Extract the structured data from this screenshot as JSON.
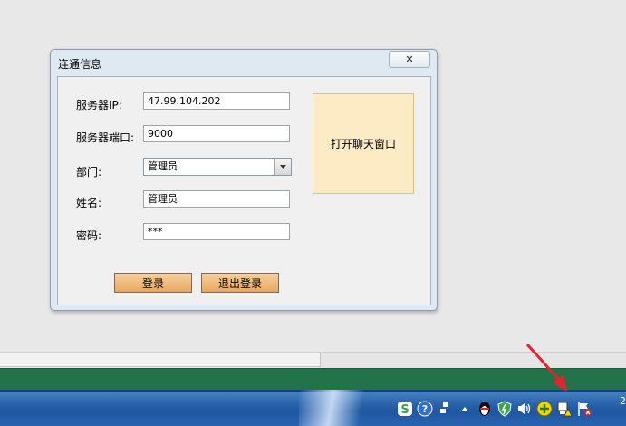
{
  "dialog": {
    "title": "连通信息",
    "close_glyph": "✕",
    "fields": {
      "server_ip": {
        "label": "服务器IP:",
        "value": "47.99.104.202"
      },
      "server_port": {
        "label": "服务器端口:",
        "value": "9000"
      },
      "department": {
        "label": "部门:",
        "selected": "管理员"
      },
      "name": {
        "label": "姓名:",
        "value": "管理员"
      },
      "password": {
        "label": "密码:",
        "value": "***"
      }
    },
    "open_chat_label": "打开聊天窗口",
    "login_label": "登录",
    "logout_label": "退出登录"
  },
  "taskbar": {
    "clock_text": "2",
    "tray_icons": [
      "sogou-s-icon",
      "help-icon",
      "network-small-icon",
      "up-arrow-icon",
      "qq-penguin-icon",
      "shield-icon",
      "volume-icon",
      "plus-circle-icon",
      "network-warning-icon",
      "flag-error-icon"
    ]
  },
  "colors": {
    "chat_button_bg": "#fdebc6",
    "action_button_bg": "#e8a860",
    "green_bar": "#22734a",
    "taskbar": "#2e67ad",
    "arrow": "#e8222a"
  }
}
